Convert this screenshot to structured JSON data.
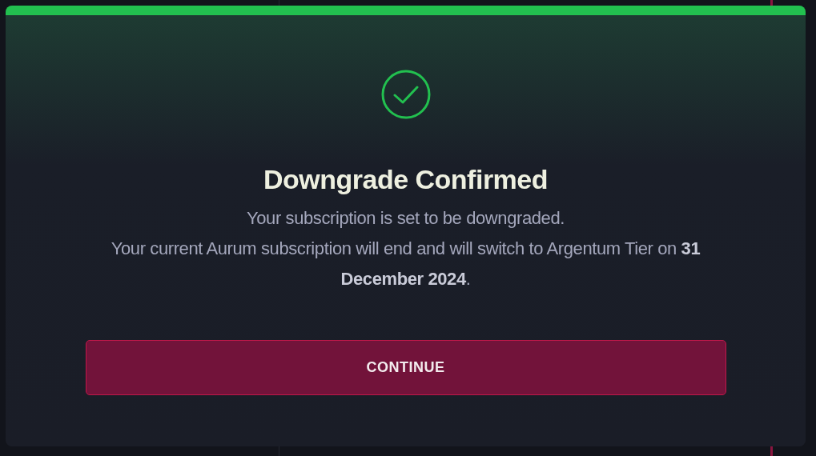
{
  "dialog": {
    "title": "Downgrade Confirmed",
    "lines": [
      "Your subscription is set to be downgraded.",
      "Your current Aurum subscription will end and will switch to Argentum Tier on **31 December 2024**."
    ],
    "button": "CONTINUE"
  }
}
